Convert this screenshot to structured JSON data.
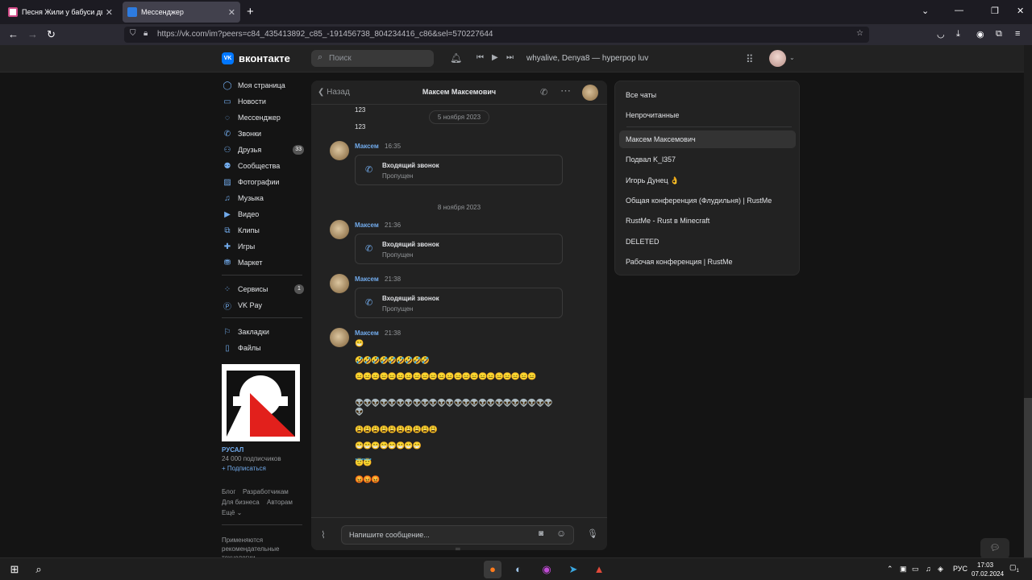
{
  "browser": {
    "tabs": [
      {
        "title": "Песня Жили у бабуси два весе",
        "active": false
      },
      {
        "title": "Мессенджер",
        "active": true
      }
    ],
    "url": "https://vk.com/im?peers=c84_435413892_c85_-191456738_804234416_c86&sel=570227644"
  },
  "header": {
    "logo_text": "вконтакте",
    "search_placeholder": "Поиск",
    "now_playing": "whyalive, Denya8 — hyperpop luv"
  },
  "sidebar": {
    "items": [
      {
        "label": "Моя страница",
        "icon": "user-circle-icon"
      },
      {
        "label": "Новости",
        "icon": "news-icon"
      },
      {
        "label": "Мессенджер",
        "icon": "message-icon"
      },
      {
        "label": "Звонки",
        "icon": "phone-icon"
      },
      {
        "label": "Друзья",
        "icon": "friends-icon",
        "badge": "33"
      },
      {
        "label": "Сообщества",
        "icon": "communities-icon"
      },
      {
        "label": "Фотографии",
        "icon": "photo-icon"
      },
      {
        "label": "Музыка",
        "icon": "music-icon"
      },
      {
        "label": "Видео",
        "icon": "video-icon"
      },
      {
        "label": "Клипы",
        "icon": "clips-icon"
      },
      {
        "label": "Игры",
        "icon": "gamepad-icon"
      },
      {
        "label": "Маркет",
        "icon": "market-icon"
      },
      {
        "label": "Сервисы",
        "icon": "services-icon",
        "badge": "1"
      },
      {
        "label": "VK Pay",
        "icon": "vkpay-icon"
      },
      {
        "label": "Закладки",
        "icon": "bookmark-icon"
      },
      {
        "label": "Файлы",
        "icon": "file-icon"
      }
    ],
    "ad": {
      "title": "РУСАЛ",
      "subscribers": "24 000 подписчиков",
      "subscribe": "+ Подписаться"
    },
    "footer": {
      "blog": "Блог",
      "developers": "Разработчикам",
      "business": "Для бизнеса",
      "authors": "Авторам",
      "more": "Ещё ⌄",
      "recommend": "Применяются рекомендательные технологии"
    }
  },
  "chat": {
    "back_label": "Назад",
    "contact_name": "Максем Максемович",
    "top_messages": [
      "123",
      "123"
    ],
    "dates": [
      "5 ноября 2023",
      "8 ноября 2023"
    ],
    "call_title": "Входящий звонок",
    "call_status": "Пропущен",
    "messages": [
      {
        "author": "Максем",
        "time": "16:35"
      },
      {
        "author": "Максем",
        "time": "21:36"
      },
      {
        "author": "Максем",
        "time": "21:38"
      },
      {
        "author": "Максем",
        "time": "21:38"
      }
    ],
    "emoji_lines": [
      "😁",
      "🤣🤣🤣🤣🤣🤣🤣🤣🤣",
      "😑😑😑😑😑😑😑😑😑😑😑😑😑😑😑😑😑😑😑😑😑😑",
      "👽👽👽👽👽👽👽👽👽👽👽👽👽👽👽👽👽👽👽👽👽👽👽👽👽",
      "😩😩😩😩😩😩😩😩😩😩",
      "😁😁😁😁😁😁😁😁",
      "😇😇",
      "😡😡😡"
    ],
    "composer_placeholder": "Напишите сообщение..."
  },
  "folders": [
    {
      "label": "Все чаты"
    },
    {
      "label": "Непрочитанные"
    },
    {
      "label": "Максем Максемович",
      "active": true
    },
    {
      "label": "Подвал K_l357"
    },
    {
      "label": "Игорь Дунец 👌"
    },
    {
      "label": "Общая конференция (Флудильня) | RustMe"
    },
    {
      "label": "RustMe - Rust в Minecraft"
    },
    {
      "label": "DELETED"
    },
    {
      "label": "Рабочая конференция | RustMe"
    }
  ],
  "taskbar": {
    "lang": "РУС",
    "time": "17:03",
    "date": "07.02.2024",
    "notif_count": "1"
  },
  "colors": {
    "accent": "#71aaeb",
    "vk_blue": "#0077ff",
    "background": "#141414",
    "panel": "#222222"
  }
}
